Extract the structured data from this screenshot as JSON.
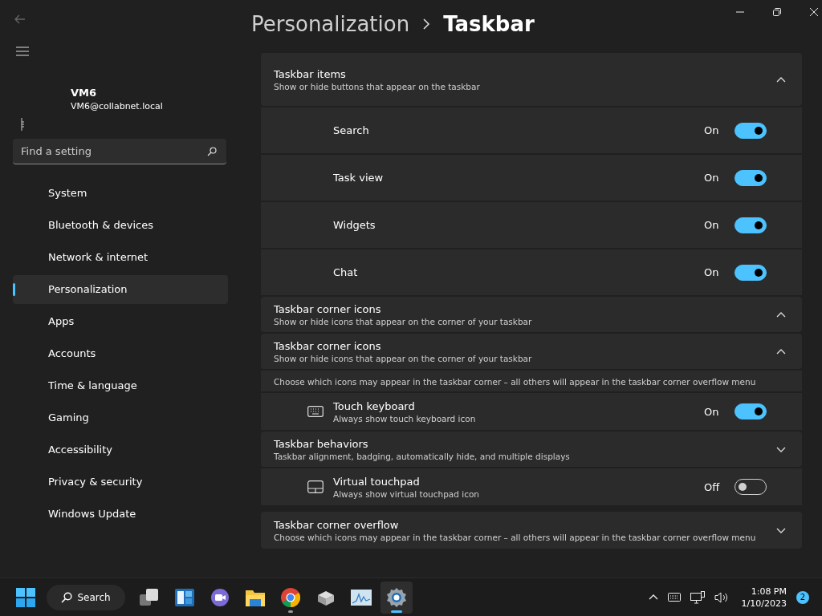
{
  "breadcrumb": {
    "parent": "Personalization",
    "current": "Taskbar"
  },
  "user": {
    "name": "VM6",
    "email": "VM6@collabnet.local"
  },
  "search": {
    "placeholder": "Find a setting"
  },
  "nav": [
    {
      "label": "System",
      "selected": false
    },
    {
      "label": "Bluetooth & devices",
      "selected": false
    },
    {
      "label": "Network & internet",
      "selected": false
    },
    {
      "label": "Personalization",
      "selected": true
    },
    {
      "label": "Apps",
      "selected": false
    },
    {
      "label": "Accounts",
      "selected": false
    },
    {
      "label": "Time & language",
      "selected": false
    },
    {
      "label": "Gaming",
      "selected": false
    },
    {
      "label": "Accessibility",
      "selected": false
    },
    {
      "label": "Privacy & security",
      "selected": false
    },
    {
      "label": "Windows Update",
      "selected": false
    }
  ],
  "sections": [
    {
      "kind": "header",
      "title": "Taskbar items",
      "subtitle": "Show or hide buttons that appear on the taskbar",
      "expanded": true
    },
    {
      "kind": "toggle",
      "label": "Search",
      "reading": "On",
      "on": true
    },
    {
      "kind": "toggle",
      "label": "Task view",
      "reading": "On",
      "on": true
    },
    {
      "kind": "toggle",
      "label": "Widgets",
      "reading": "On",
      "on": true
    },
    {
      "kind": "toggle",
      "label": "Chat",
      "reading": "On",
      "on": true
    },
    {
      "kind": "header",
      "title": "Taskbar corner icons",
      "subtitle": "Show or hide icons that appear on the corner of your taskbar",
      "expanded": true
    },
    {
      "kind": "header",
      "title": "Taskbar corner icons",
      "subtitle": "Show or hide icons that appear on the corner of your taskbar",
      "expanded": true
    },
    {
      "kind": "note",
      "text": "Choose which icons may appear in the taskbar corner – all others will appear in the taskbar corner overflow menu"
    },
    {
      "kind": "keyboard",
      "label": "Touch keyboard",
      "subtitle": "Always show touch keyboard icon",
      "reading": "On",
      "on": true
    },
    {
      "kind": "header",
      "title": "Taskbar behaviors",
      "subtitle": "Taskbar alignment, badging, automatically hide, and multiple displays",
      "expanded": false
    },
    {
      "kind": "touchpad",
      "label": "Virtual touchpad",
      "subtitle": "Always show virtual touchpad icon",
      "reading": "Off",
      "on": false
    },
    {
      "kind": "header",
      "title": "Taskbar corner overflow",
      "subtitle": "Choose which icons may appear in the taskbar corner – all others will appear in the taskbar corner overflow menu",
      "expanded": false
    }
  ],
  "taskbar": {
    "search_label": "Search",
    "time": "1:08 PM",
    "date": "1/10/2023",
    "notifications": "2",
    "apps": [
      {
        "kind": "taskview",
        "running": false,
        "selected": false
      },
      {
        "kind": "widgets",
        "running": false,
        "selected": false
      },
      {
        "kind": "chat",
        "running": false,
        "selected": false
      },
      {
        "kind": "explorer",
        "running": false,
        "selected": false
      },
      {
        "kind": "chrome",
        "running": true,
        "selected": false
      },
      {
        "kind": "package",
        "running": false,
        "selected": false
      },
      {
        "kind": "monitor",
        "running": false,
        "selected": false
      },
      {
        "kind": "settings",
        "running": true,
        "selected": true
      }
    ]
  }
}
